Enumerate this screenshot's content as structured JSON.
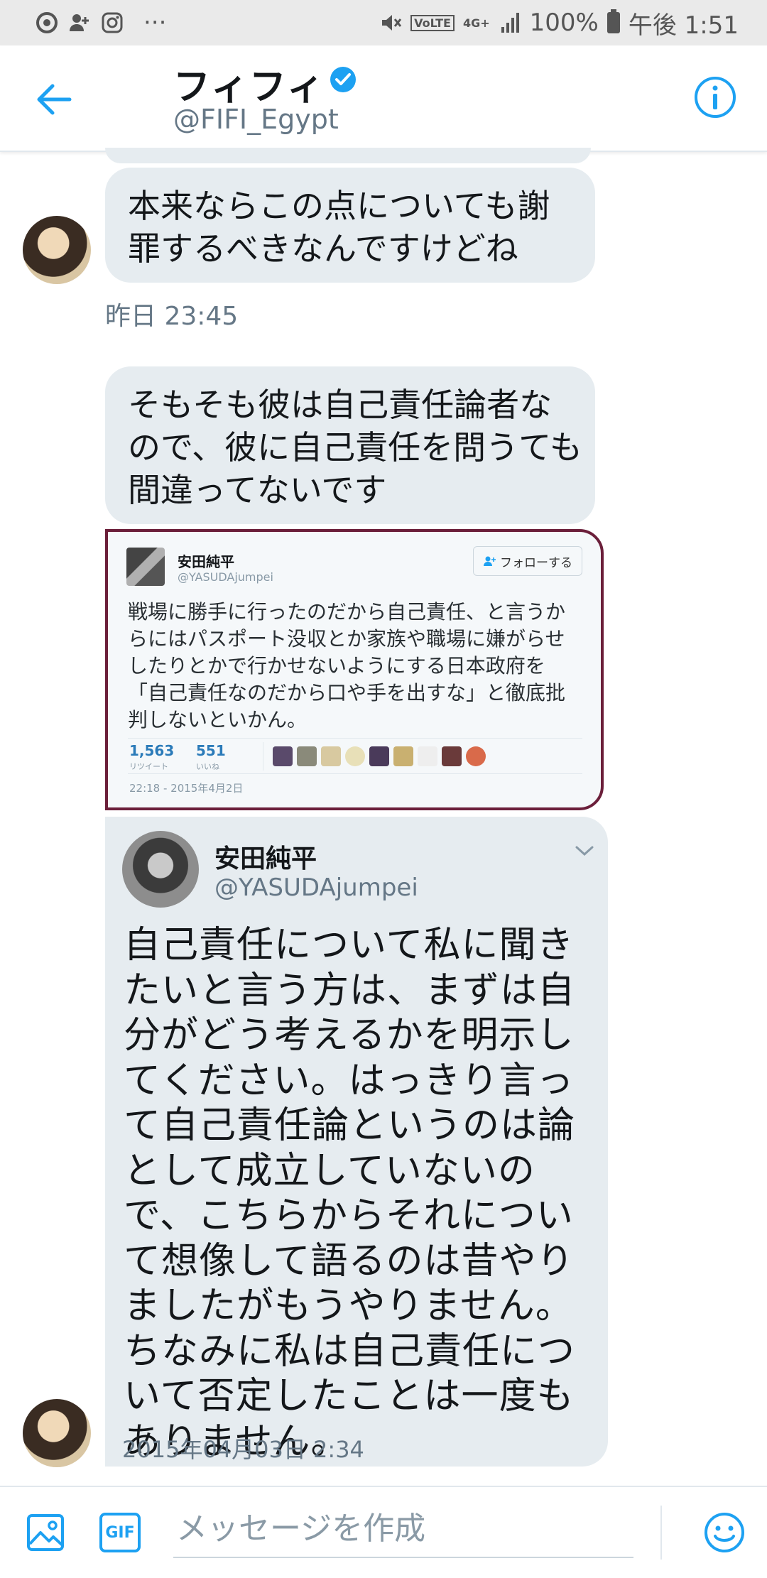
{
  "status_bar": {
    "network": "4G+",
    "volte": "VoLTE",
    "battery": "100%",
    "time": "午後 1:51",
    "dots": "···"
  },
  "header": {
    "name": "フィフィ",
    "handle": "@FIFI_Egypt",
    "accent": "#1da1f2"
  },
  "messages": [
    {
      "text": "本来ならこの点についても謝罪するべきなんですけどね"
    },
    {
      "text": "そもそも彼は自己責任論者なので、彼に自己責任を問うても間違ってないです"
    }
  ],
  "timestamp1": "昨日 23:45",
  "screenshot_card": {
    "name": "安田純平",
    "handle": "@YASUDAjumpei",
    "follow_label": "フォローする",
    "text": "戦場に勝手に行ったのだから自己責任、と言うからにはパスポート没収とか家族や職場に嫌がらせしたりとかで行かせないようにする日本政府を「自己責任なのだから口や手を出すな」と徹底批判しないといかん。",
    "retweets": "1,563",
    "retweets_label": "リツイート",
    "likes": "551",
    "likes_label": "いいね",
    "date": "22:18 - 2015年4月2日"
  },
  "tweet_card": {
    "name": "安田純平",
    "handle": "@YASUDAjumpei",
    "text": "自己責任について私に聞きたいと言う方は、まずは自分がどう考えるかを明示してください。はっきり言って自己責任論というのは論として成立していないので、こちらからそれについて想像して語るのは昔やりましたがもうやりません。ちなみに私は自己責任について否定したことは一度もありません。",
    "date": "2015年04月03日 2:34"
  },
  "composer": {
    "placeholder": "メッセージを作成",
    "gif_label": "GIF"
  }
}
